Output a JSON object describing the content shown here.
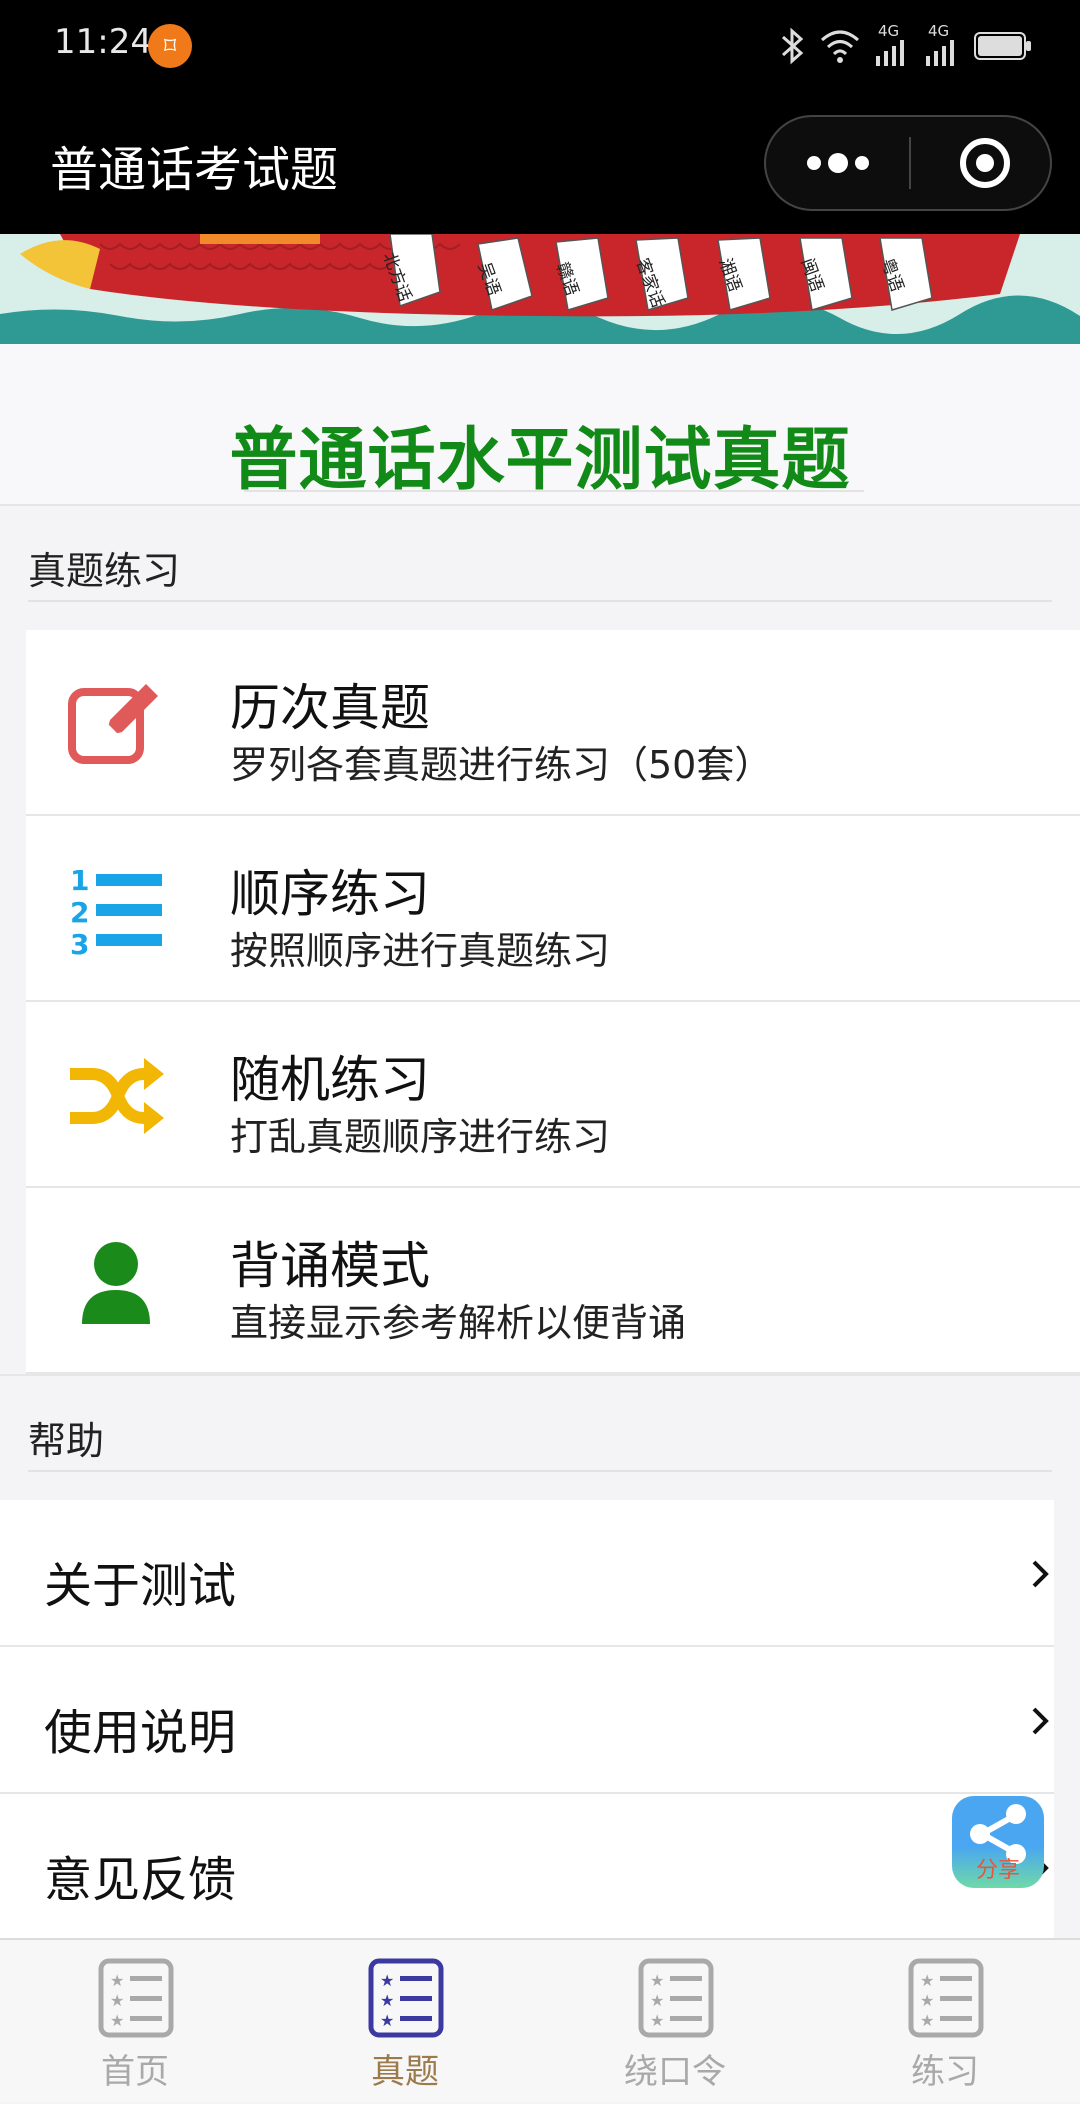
{
  "status_bar": {
    "time": "11:24",
    "notification_glyph": "⌑",
    "network_label_1": "4G",
    "network_label_2": "4G"
  },
  "nav": {
    "title": "普通话考试题",
    "more_icon": "more-dots-icon",
    "close_icon": "target-close-icon"
  },
  "banner": {
    "labels": [
      "北方话",
      "吴语",
      "赣语",
      "客家话",
      "湘语",
      "闽语",
      "粤语"
    ]
  },
  "page": {
    "title": "普通话水平测试真题",
    "title_color": "#128a17"
  },
  "practice_section": {
    "label": "真题练习",
    "items": [
      {
        "title": "历次真题",
        "desc": "罗列各套真题进行练习（50套）",
        "icon": "edit-icon",
        "color": "#e05a5a"
      },
      {
        "title": "顺序练习",
        "desc": "按照顺序进行真题练习",
        "icon": "numbered-list-icon",
        "color": "#1aa4e8"
      },
      {
        "title": "随机练习",
        "desc": "打乱真题顺序进行练习",
        "icon": "shuffle-icon",
        "color": "#f2b705"
      },
      {
        "title": "背诵模式",
        "desc": "直接显示参考解析以便背诵",
        "icon": "user-icon",
        "color": "#1a8a1a"
      }
    ]
  },
  "help_section": {
    "label": "帮助",
    "items": [
      {
        "label": "关于测试"
      },
      {
        "label": "使用说明"
      },
      {
        "label": "意见反馈"
      }
    ]
  },
  "share": {
    "label": "分享"
  },
  "tabs": [
    {
      "label": "首页",
      "active": false
    },
    {
      "label": "真题",
      "active": true
    },
    {
      "label": "绕口令",
      "active": false
    },
    {
      "label": "练习",
      "active": false
    }
  ],
  "colors": {
    "tab_active": "#9b7a4c",
    "tab_inactive": "#a9a9a9",
    "tab_icon_active": "#3c3aa0"
  }
}
